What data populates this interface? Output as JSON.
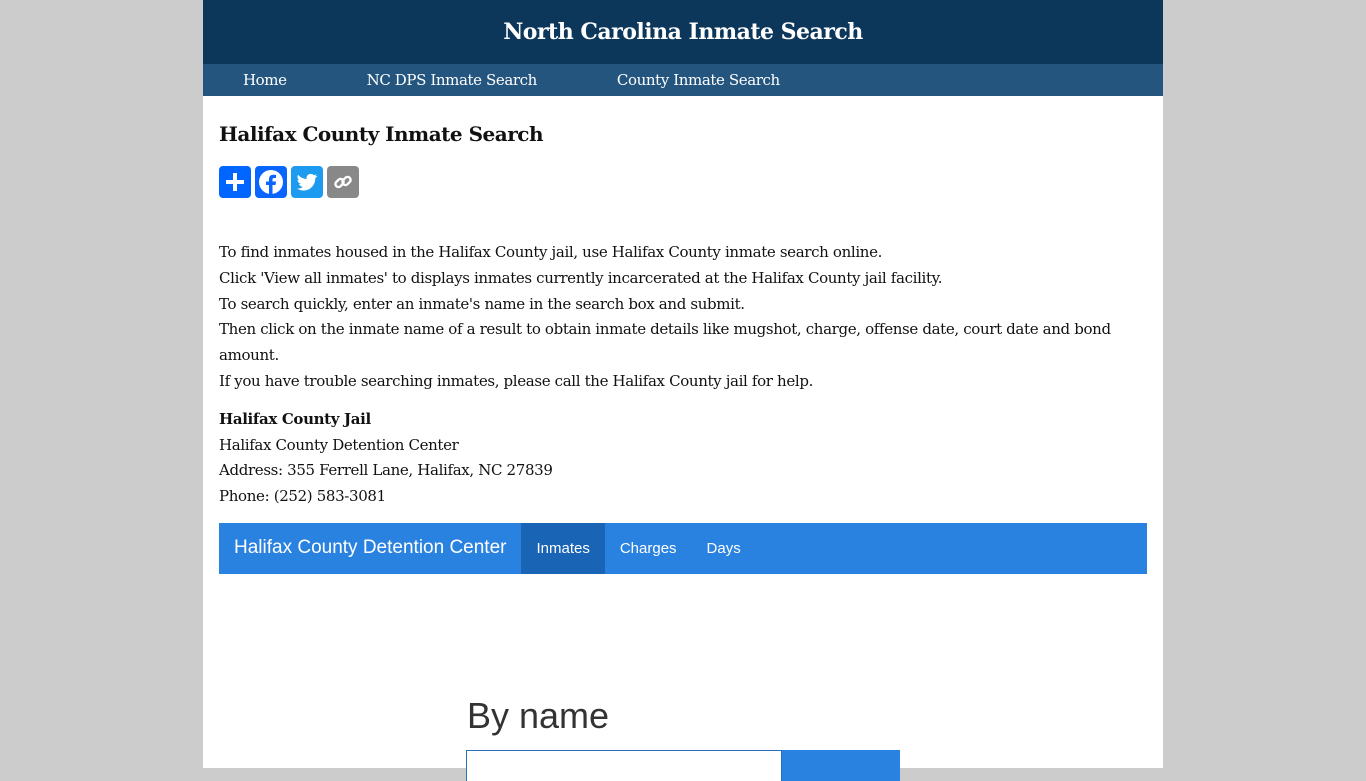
{
  "header": {
    "title": "North Carolina Inmate Search"
  },
  "topnav": {
    "items": [
      {
        "label": "Home"
      },
      {
        "label": "NC DPS Inmate Search"
      },
      {
        "label": "County Inmate Search"
      }
    ]
  },
  "page": {
    "title": "Halifax County Inmate Search",
    "share_buttons": [
      {
        "icon": "plus-share-icon",
        "color": "#0166ff"
      },
      {
        "icon": "facebook-icon",
        "color": "#0866ff"
      },
      {
        "icon": "twitter-icon",
        "color": "#1d9bf0"
      },
      {
        "icon": "copy-link-icon",
        "color": "#888888"
      }
    ],
    "intro": [
      "To find inmates housed in the Halifax County jail, use Halifax County inmate search online.",
      "Click 'View all inmates' to displays inmates currently incarcerated at the Halifax County jail facility.",
      "To search quickly, enter an inmate's name in the search box and submit.",
      "Then click on the inmate name of a result to obtain inmate details like mugshot, charge, offense date, court date and bond amount.",
      "If you have trouble searching inmates, please call the Halifax County jail for help."
    ],
    "jail": {
      "name": "Halifax County Jail",
      "facility": "Halifax County Detention Center",
      "address": "Address: 355 Ferrell Lane, Halifax, NC 27839",
      "phone": "Phone: (252) 583-3081"
    }
  },
  "widget": {
    "brand": "Halifax County Detention Center",
    "tabs": [
      {
        "label": "Inmates",
        "active": true
      },
      {
        "label": "Charges",
        "active": false
      },
      {
        "label": "Days",
        "active": false
      }
    ],
    "search_heading": "By name",
    "search_value": ""
  },
  "colors": {
    "header_bg": "#0c365a",
    "nav_bg": "#23557f",
    "widget_blue": "#2a82e0",
    "widget_active": "#1a64b5"
  }
}
